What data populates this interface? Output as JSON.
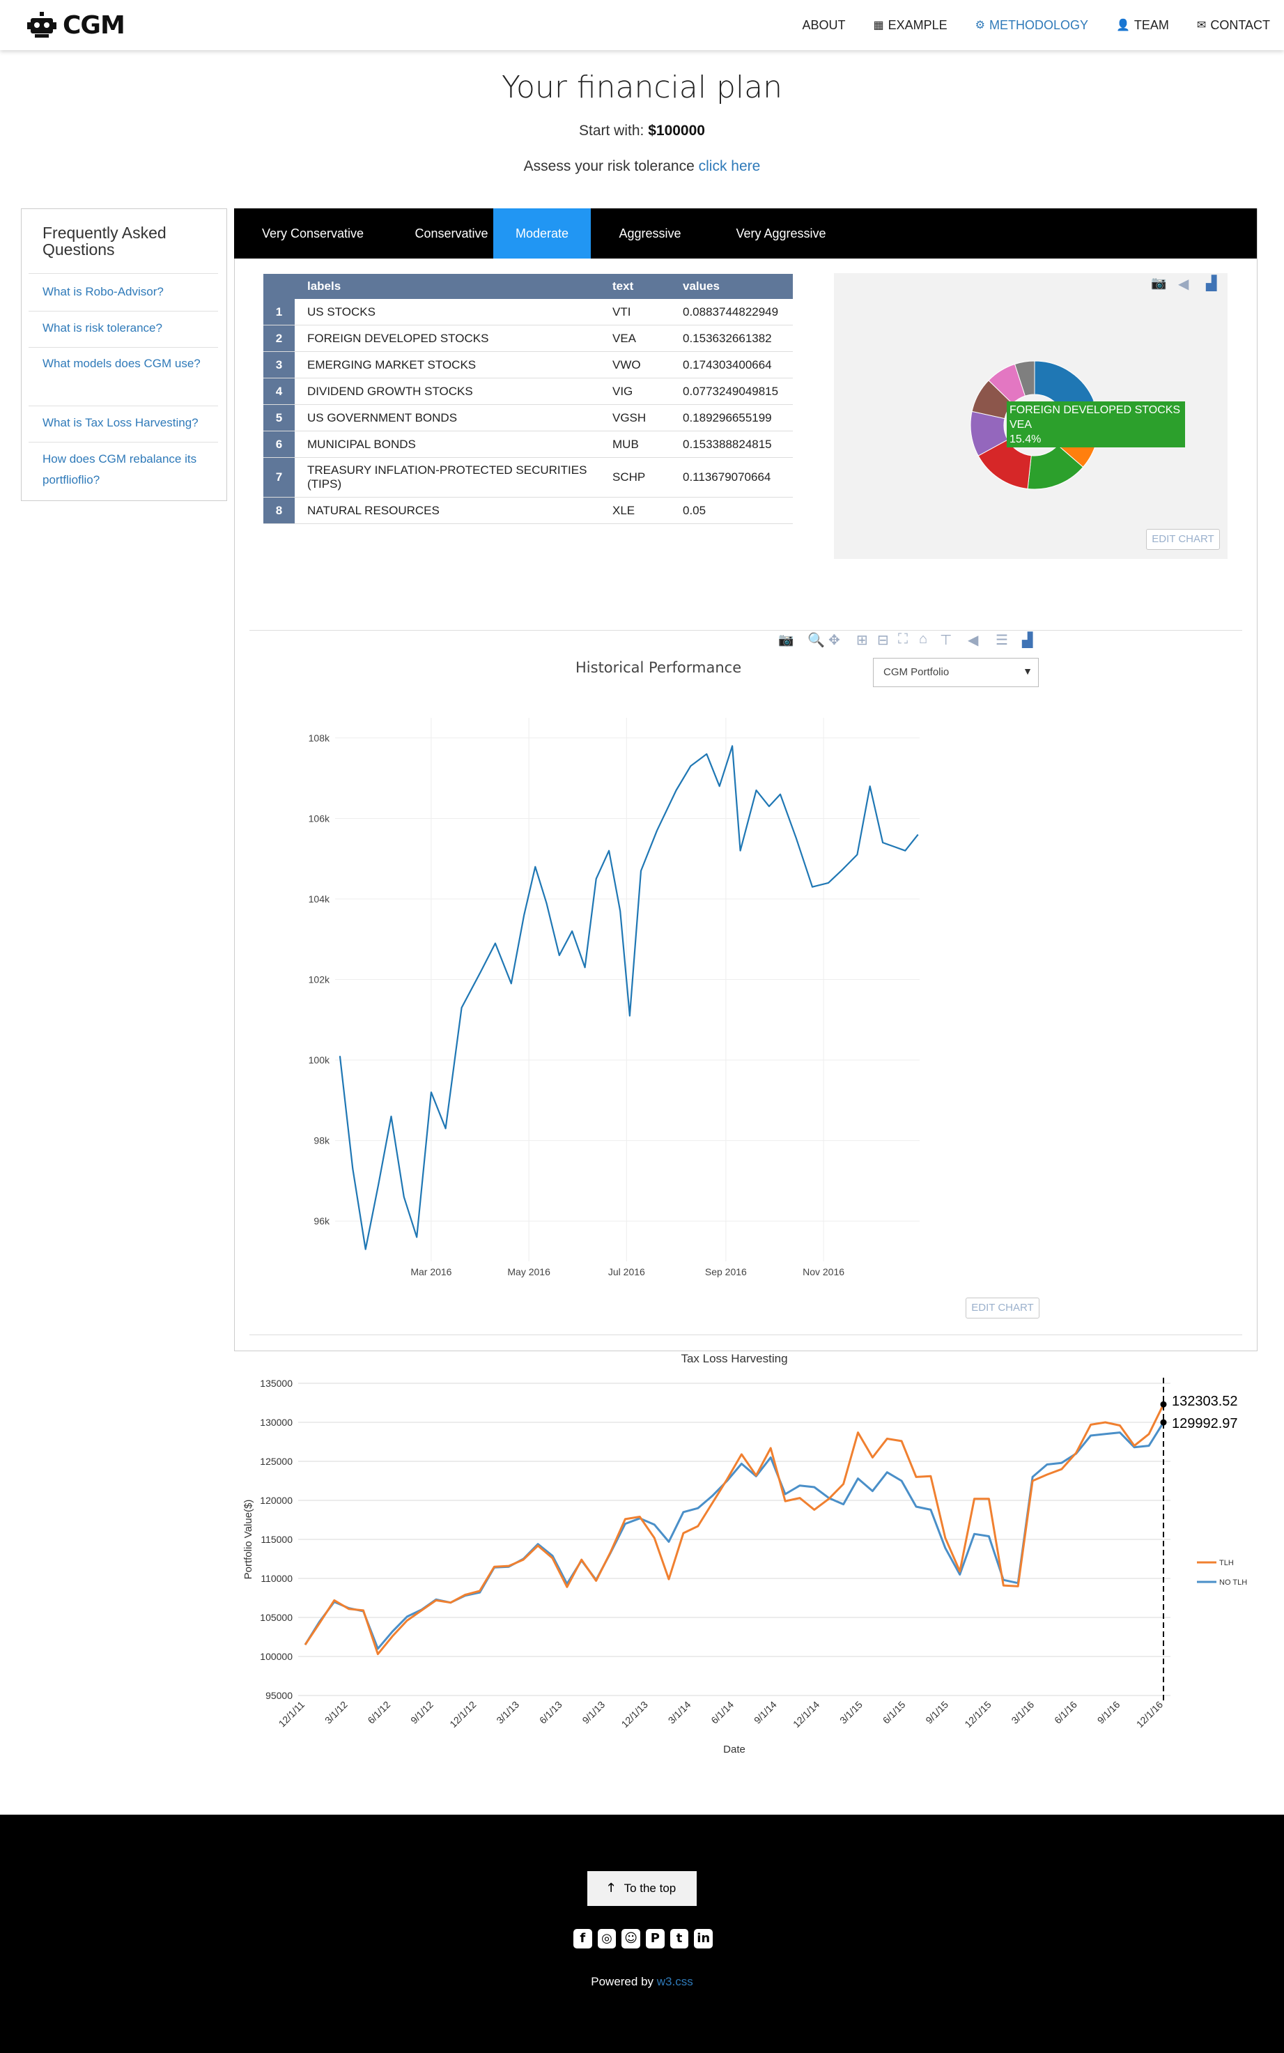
{
  "nav": {
    "brand": "CGM",
    "links": [
      {
        "label": "ABOUT",
        "icon": ""
      },
      {
        "label": "EXAMPLE",
        "icon": "grid-icon"
      },
      {
        "label": "METHODOLOGY",
        "icon": "gears-icon"
      },
      {
        "label": "TEAM",
        "icon": "user-icon"
      },
      {
        "label": "CONTACT",
        "icon": "envelope-icon"
      }
    ],
    "active": "METHODOLOGY"
  },
  "header": {
    "title": "Your financial plan",
    "start_label": "Start with:",
    "start_value": "$100000",
    "risk_text": "Assess your risk tolerance",
    "risk_link": "click here"
  },
  "faq": {
    "title": "Frequently Asked Questions",
    "items": [
      "What is Robo-Advisor?",
      "What is risk tolerance?",
      "What models does CGM use?",
      "What is Tax Loss Harvesting?",
      "How does CGM rebalance its portflioflio?"
    ]
  },
  "tabs": {
    "items": [
      "Very Conservative",
      "Conservative",
      "Moderate",
      "Aggressive",
      "Very Aggressive"
    ],
    "active": "Moderate"
  },
  "allocation": {
    "headers": [
      "labels",
      "text",
      "values"
    ],
    "rows": [
      {
        "idx": "1",
        "label": "US STOCKS",
        "ticker": "VTI",
        "value": "0.0883744822949"
      },
      {
        "idx": "2",
        "label": "FOREIGN DEVELOPED STOCKS",
        "ticker": "VEA",
        "value": "0.153632661382"
      },
      {
        "idx": "3",
        "label": "EMERGING MARKET STOCKS",
        "ticker": "VWO",
        "value": "0.174303400664"
      },
      {
        "idx": "4",
        "label": "DIVIDEND GROWTH STOCKS",
        "ticker": "VIG",
        "value": "0.0773249049815"
      },
      {
        "idx": "5",
        "label": "US GOVERNMENT BONDS",
        "ticker": "VGSH",
        "value": "0.189296655199"
      },
      {
        "idx": "6",
        "label": "MUNICIPAL BONDS",
        "ticker": "MUB",
        "value": "0.153388824815"
      },
      {
        "idx": "7",
        "label": "TREASURY INFLATION-PROTECTED SECURITIES (TIPS)",
        "ticker": "SCHP",
        "value": "0.113679070664"
      },
      {
        "idx": "8",
        "label": "NATURAL RESOURCES",
        "ticker": "XLE",
        "value": "0.05"
      }
    ]
  },
  "pie": {
    "hover_label": "FOREIGN DEVELOPED STOCKS",
    "hover_ticker": "VEA",
    "hover_pct": "15.4%",
    "edit_label": "EDIT CHART",
    "hover_color": "#2ca02c"
  },
  "performance": {
    "title": "Historical Performance",
    "select_value": "CGM Portfolio",
    "edit_label": "EDIT CHART"
  },
  "chart_data": [
    {
      "type": "pie",
      "hole": true,
      "labels": [
        "US GOVERNMENT BONDS",
        "EMERGING MARKET STOCKS",
        "FOREIGN DEVELOPED STOCKS",
        "MUNICIPAL BONDS",
        "TREASURY INFLATION-PROTECTED SECURITIES (TIPS)",
        "US STOCKS",
        "DIVIDEND GROWTH STOCKS",
        "NATURAL RESOURCES"
      ],
      "values": [
        0.189296655199,
        0.174303400664,
        0.153632661382,
        0.153388824815,
        0.113679070664,
        0.0883744822949,
        0.0773249049815,
        0.05
      ],
      "colors": [
        "#1f77b4",
        "#ff7f0e",
        "#2ca02c",
        "#d62728",
        "#9467bd",
        "#8c564b",
        "#e377c2",
        "#7f7f7f"
      ]
    },
    {
      "type": "line",
      "title": "Historical Performance",
      "x_tick_labels": [
        "Mar 2016",
        "May 2016",
        "Jul 2016",
        "Sep 2016",
        "Nov 2016"
      ],
      "y_tick_labels": [
        "96k",
        "98k",
        "100k",
        "102k",
        "104k",
        "106k",
        "108k"
      ],
      "ylim": [
        95000,
        108500
      ],
      "series_color": "#1f77b4",
      "dates": [
        "2016-01-04",
        "2016-01-12",
        "2016-01-20",
        "2016-01-28",
        "2016-02-05",
        "2016-02-13",
        "2016-02-21",
        "2016-03-01",
        "2016-03-10",
        "2016-03-20",
        "2016-04-01",
        "2016-04-10",
        "2016-04-20",
        "2016-04-28",
        "2016-05-05",
        "2016-05-12",
        "2016-05-20",
        "2016-05-28",
        "2016-06-05",
        "2016-06-12",
        "2016-06-20",
        "2016-06-27",
        "2016-07-03",
        "2016-07-10",
        "2016-07-20",
        "2016-08-01",
        "2016-08-10",
        "2016-08-20",
        "2016-08-28",
        "2016-09-05",
        "2016-09-10",
        "2016-09-20",
        "2016-09-28",
        "2016-10-05",
        "2016-10-15",
        "2016-10-25",
        "2016-11-04",
        "2016-11-12",
        "2016-11-22",
        "2016-11-30",
        "2016-12-08",
        "2016-12-15",
        "2016-12-22",
        "2016-12-30"
      ],
      "values": [
        100100,
        97300,
        95300,
        96900,
        98600,
        96600,
        95600,
        99200,
        98300,
        101300,
        102200,
        102900,
        101900,
        103600,
        104800,
        103900,
        102600,
        103200,
        102300,
        104500,
        105200,
        103700,
        101100,
        104700,
        105700,
        106700,
        107300,
        107600,
        106800,
        107800,
        105200,
        106700,
        106300,
        106600,
        105500,
        104300,
        104400,
        104700,
        105100,
        106800,
        105400,
        105300,
        105200,
        105600
      ]
    },
    {
      "type": "line",
      "title": "Tax Loss Harvesting",
      "xlabel": "Date",
      "ylabel": "Portfolio Value($)",
      "ylim": [
        95000,
        135000
      ],
      "y_ticks": [
        95000,
        100000,
        105000,
        110000,
        115000,
        120000,
        125000,
        130000,
        135000
      ],
      "x_tick_labels": [
        "12/1/11",
        "3/1/12",
        "6/1/12",
        "9/1/12",
        "12/1/12",
        "3/1/13",
        "6/1/13",
        "9/1/13",
        "12/1/13",
        "3/1/14",
        "6/1/14",
        "9/1/14",
        "12/1/14",
        "3/1/15",
        "6/1/15",
        "9/1/15",
        "12/1/15",
        "3/1/16",
        "6/1/16",
        "9/1/16",
        "12/1/16"
      ],
      "end_labels": [
        "132303.52",
        "129992.97"
      ],
      "legend_position": "right",
      "series": [
        {
          "name": "TLH",
          "color": "#f08030",
          "values": [
            101500,
            104300,
            107200,
            106100,
            105900,
            100300,
            102600,
            104600,
            105900,
            107200,
            106900,
            107900,
            108400,
            111500,
            111600,
            112400,
            114200,
            112600,
            108900,
            112400,
            109700,
            113400,
            117600,
            117900,
            115200,
            109900,
            115800,
            116700,
            119700,
            122700,
            125900,
            123200,
            126700,
            119900,
            120300,
            118800,
            120200,
            122100,
            128700,
            125500,
            127900,
            127600,
            123000,
            123100,
            115200,
            110900,
            120200,
            120200,
            109100,
            109000,
            122500,
            123300,
            124000,
            126100,
            129700,
            130000,
            129600,
            127000,
            128500,
            132303
          ]
        },
        {
          "name": "NO TLH",
          "color": "#4a8fc8",
          "values": [
            101500,
            104500,
            107000,
            106200,
            105800,
            101000,
            103200,
            105100,
            106000,
            107300,
            106900,
            107800,
            108200,
            111400,
            111500,
            112500,
            114400,
            112900,
            109300,
            112300,
            109800,
            113300,
            117000,
            117700,
            116900,
            114700,
            118500,
            119000,
            120600,
            122500,
            124700,
            123100,
            125500,
            120800,
            121900,
            121700,
            120300,
            119500,
            122800,
            121200,
            123600,
            122500,
            119200,
            118800,
            113900,
            110500,
            115700,
            115400,
            109800,
            109400,
            123000,
            124600,
            124800,
            126000,
            128300,
            128500,
            128700,
            126800,
            127000,
            129993
          ]
        }
      ]
    }
  ],
  "footer": {
    "totop": "To the top",
    "powered_prefix": "Powered by",
    "powered_link": "w3.css",
    "social": [
      "facebook-icon",
      "instagram-icon",
      "snapchat-icon",
      "pinterest-icon",
      "twitter-icon",
      "linkedin-icon"
    ]
  }
}
